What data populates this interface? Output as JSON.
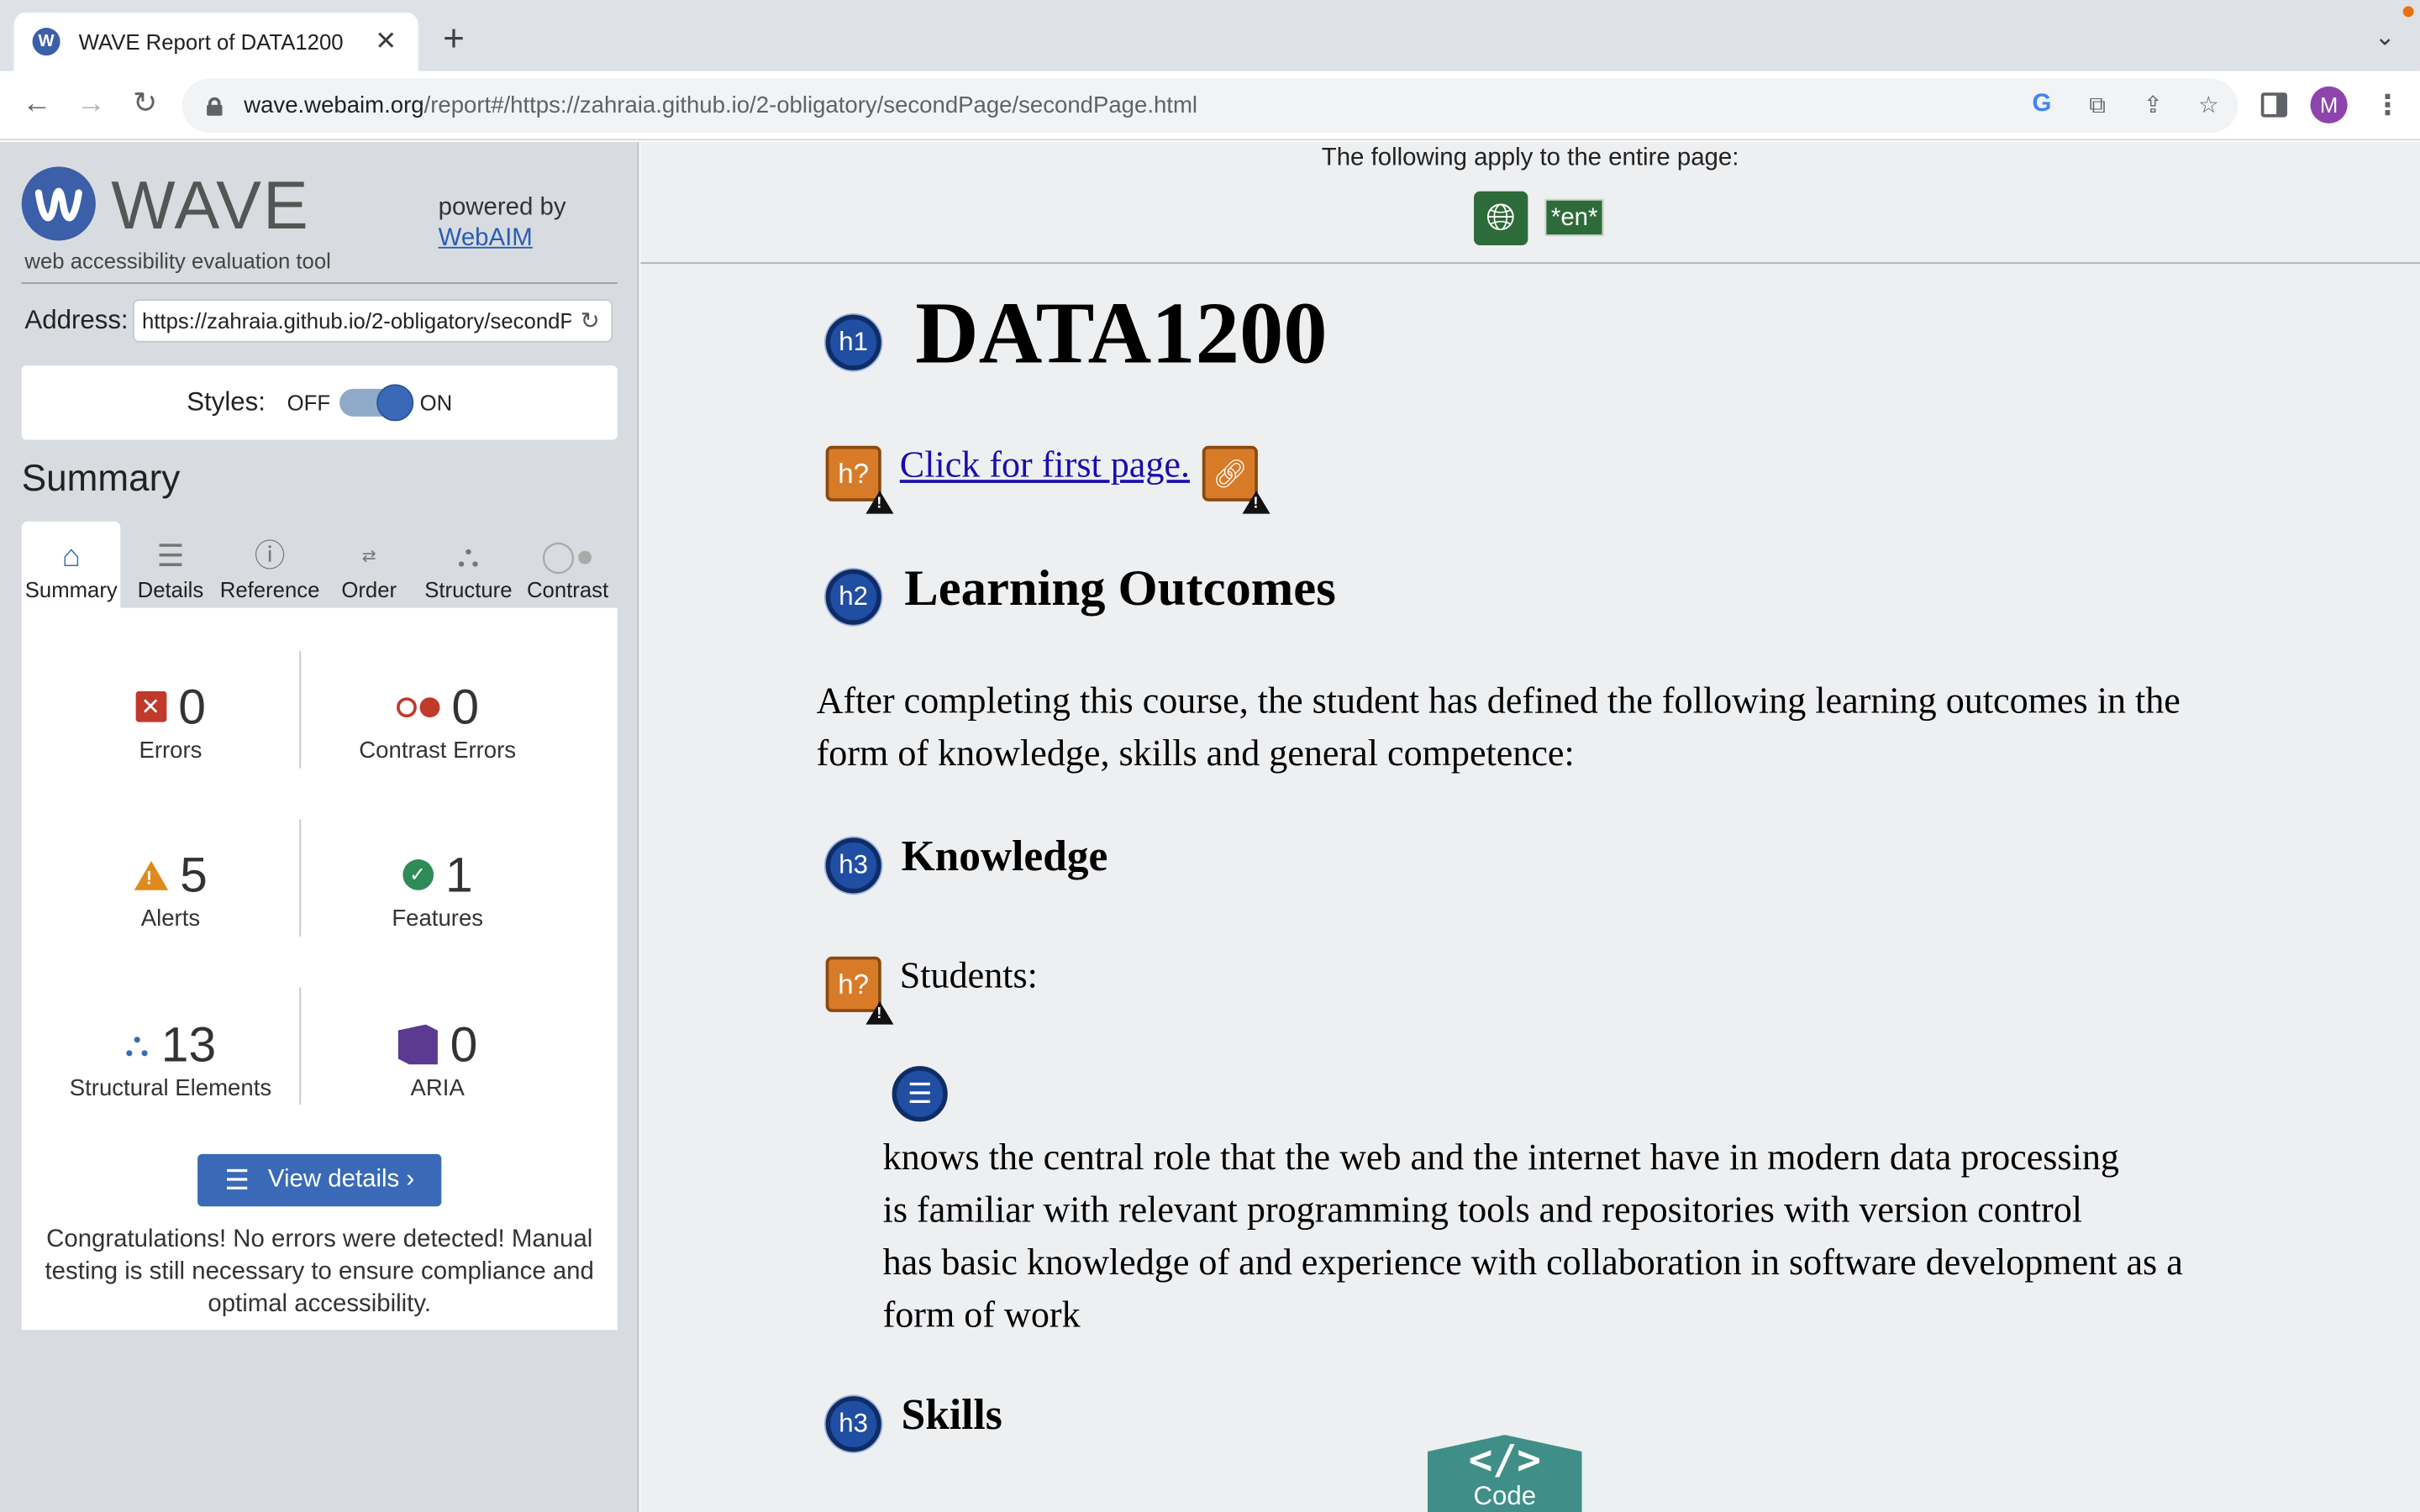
{
  "browser": {
    "tab_title": "WAVE Report of DATA1200",
    "tab_favicon": "W",
    "url_host": "wave.webaim.org",
    "url_path": "/report#/https://zahraia.github.io/2-obligatory/secondPage/secondPage.html",
    "avatar_letter": "M"
  },
  "wave": {
    "logo_letter": "W",
    "title": "WAVE",
    "subtitle": "web accessibility evaluation tool",
    "powered_by": "powered by",
    "powered_link": "WebAIM",
    "address_label": "Address:",
    "address_value": "https://zahraia.github.io/2-obligatory/secondPage/secondPage.html",
    "styles_label": "Styles:",
    "styles_off": "OFF",
    "styles_on": "ON",
    "summary_heading": "Summary",
    "tabs": [
      {
        "label": "Summary",
        "icon": "home-icon",
        "active": true
      },
      {
        "label": "Details",
        "icon": "list-icon"
      },
      {
        "label": "Reference",
        "icon": "info-icon"
      },
      {
        "label": "Order",
        "icon": "order-icon"
      },
      {
        "label": "Structure",
        "icon": "structure-icon"
      },
      {
        "label": "Contrast",
        "icon": "contrast-icon"
      }
    ],
    "stats": {
      "errors": {
        "value": "0",
        "label": "Errors"
      },
      "contrast_errors": {
        "value": "0",
        "label": "Contrast Errors"
      },
      "alerts": {
        "value": "5",
        "label": "Alerts"
      },
      "features": {
        "value": "1",
        "label": "Features"
      },
      "structural": {
        "value": "13",
        "label": "Structural Elements"
      },
      "aria": {
        "value": "0",
        "label": "ARIA"
      }
    },
    "view_details": "View details ›",
    "congrats": "Congratulations! No errors were detected! Manual testing is still necessary to ensure compliance and optimal accessibility."
  },
  "report": {
    "page_notice": "The following apply to the entire page:",
    "lang_badge": "*en*",
    "badges": {
      "h1": "h1",
      "h2": "h2",
      "h3": "h3",
      "unknown": "h?"
    },
    "h1": "DATA1200",
    "link": "Click for first page.",
    "h2": "Learning Outcomes",
    "paragraph": "After completing this course, the student has defined the following learning outcomes in the form of knowledge, skills and general competence:",
    "h3_knowledge": "Knowledge",
    "students": "Students:",
    "list_items": [
      "knows the central role that the web and the internet have in modern data processing",
      "is familiar with relevant programming tools and repositories with version control",
      "has basic knowledge of and experience with collaboration in software development as a form of work"
    ],
    "h3_skills": "Skills",
    "code_symbol": "</>",
    "code_label": "Code"
  },
  "colors": {
    "wave_blue": "#3a6ab7",
    "error_red": "#c0392b",
    "alert_orange": "#e08a1e",
    "feature_green": "#2e8b57",
    "aria_purple": "#5b3a91",
    "code_teal": "#3f8f88"
  }
}
